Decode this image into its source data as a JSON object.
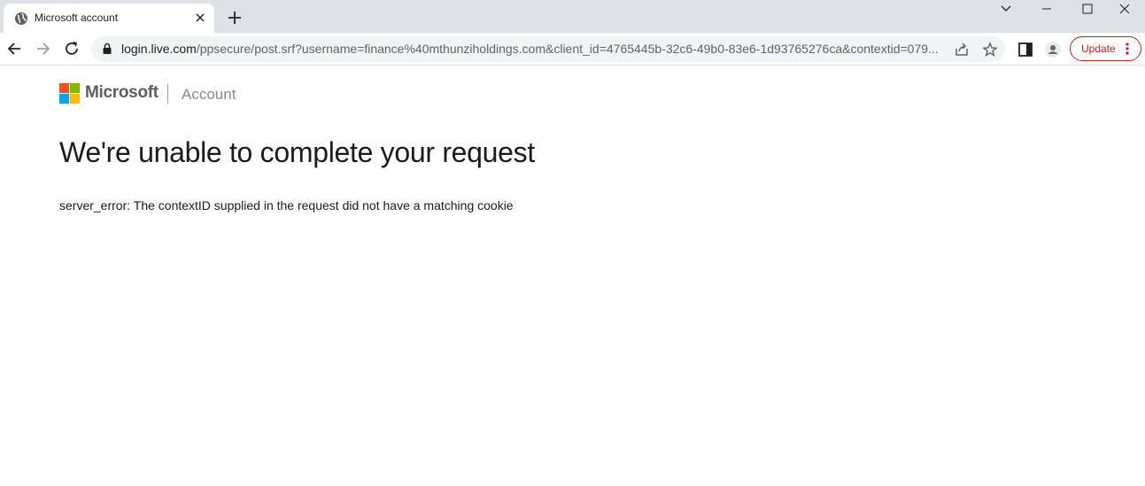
{
  "browser": {
    "tab": {
      "title": "Microsoft account",
      "favicon": "globe-icon"
    },
    "url": {
      "host": "login.live.com",
      "path": "/ppsecure/post.srf?username=finance%40mthunziholdings.com&client_id=4765445b-32c6-49b0-83e6-1d93765276ca&contextid=079..."
    },
    "update_label": "Update",
    "colors": {
      "tabstrip": "#dee1e6",
      "update_accent": "#c5221f",
      "omnibox": "#f1f3f4"
    }
  },
  "page": {
    "brand": "Microsoft",
    "section": "Account",
    "heading": "We're unable to complete your request",
    "error_message": "server_error: The contextID supplied in the request did not have a matching cookie",
    "logo_colors": [
      "#f25022",
      "#7fba00",
      "#00a4ef",
      "#ffb900"
    ]
  }
}
